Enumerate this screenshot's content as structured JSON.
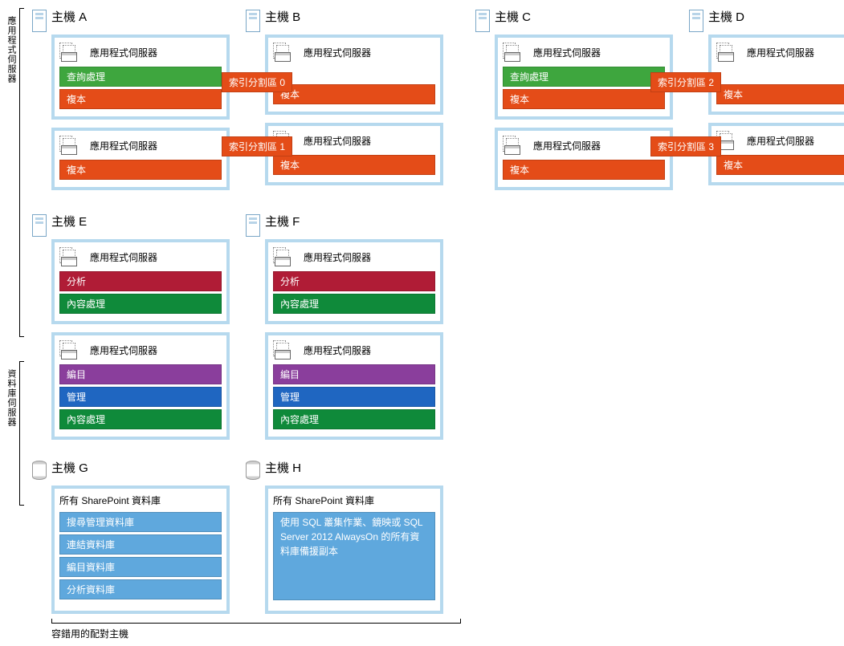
{
  "section_labels": {
    "app_servers": "應用程式伺服器",
    "db_servers": "資料庫伺服器"
  },
  "app_server_label": "應用程式伺服器",
  "hosts": {
    "A": {
      "title": "主機 A"
    },
    "B": {
      "title": "主機 B"
    },
    "C": {
      "title": "主機 C"
    },
    "D": {
      "title": "主機 D"
    },
    "E": {
      "title": "主機 E"
    },
    "F": {
      "title": "主機 F"
    },
    "G": {
      "title": "主機 G"
    },
    "H": {
      "title": "主機 H"
    }
  },
  "components": {
    "query_processing": "查詢處理",
    "replica": "複本",
    "analysis": "分析",
    "content_processing": "內容處理",
    "catalog": "編目",
    "admin": "管理"
  },
  "index_partitions": {
    "p0": "索引分割區 0",
    "p1": "索引分割區 1",
    "p2": "索引分割區 2",
    "p3": "索引分割區 3"
  },
  "db": {
    "header": "所有 SharePoint 資料庫",
    "search_admin_db": "搜尋管理資料庫",
    "link_db": "連結資料庫",
    "catalog_db": "編目資料庫",
    "analysis_db": "分析資料庫",
    "mirror_note": "使用 SQL 叢集作業、鏡映或 SQL Server 2012 AlwaysOn 的所有資料庫備援副本"
  },
  "footnote": "容錯用的配對主機",
  "colors": {
    "green": "#3ea63e",
    "orange": "#e44c18",
    "crimson": "#b01c36",
    "green2": "#0f8a3a",
    "purple": "#8a3e9c",
    "blue": "#1f66c1",
    "sky": "#5fa8dd",
    "border": "#b6d9ee"
  }
}
